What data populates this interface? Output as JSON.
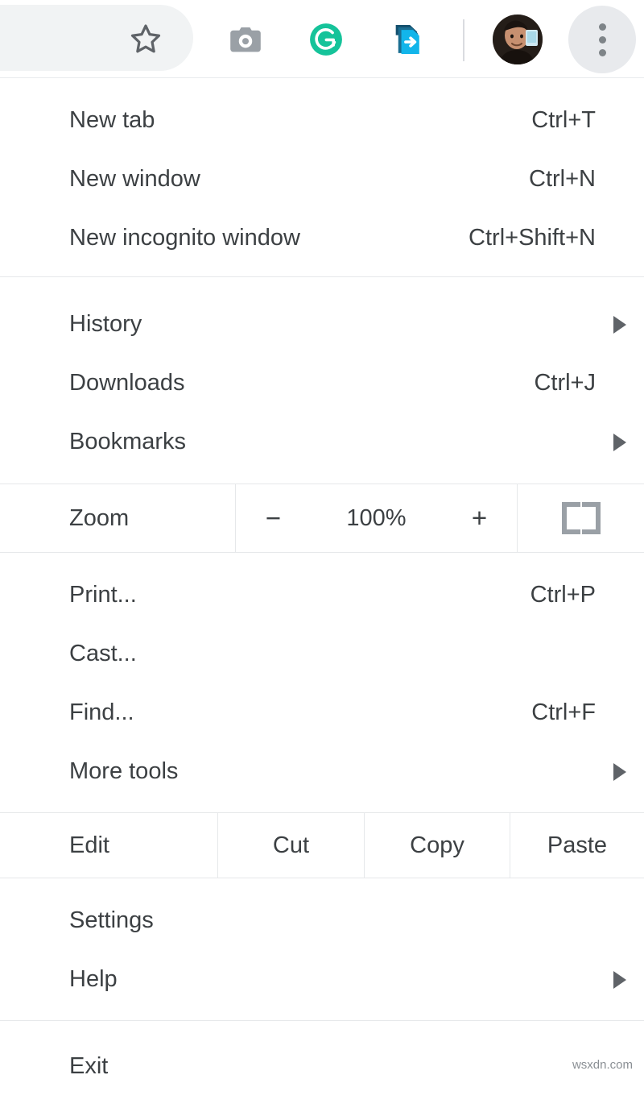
{
  "toolbar": {
    "bookmark_star_tooltip": "Bookmark this tab",
    "screenshot_tooltip": "Screenshot extension",
    "grammarly_letter": "G",
    "grammarly_tooltip": "Grammarly",
    "export_tooltip": "Save to extension",
    "avatar_tooltip": "Profile",
    "menu_tooltip": "Customize and control Google Chrome",
    "colors": {
      "omnibox_bg": "#f1f3f4",
      "icon_gray": "#8a8f94",
      "grammarly_green": "#15c39a",
      "export_blue": "#12b5ea",
      "export_navy": "#14506e",
      "menu_button_bg": "#e8eaed",
      "divider": "#e6e8ea"
    }
  },
  "menu": {
    "sections": [
      {
        "name": "new",
        "items": [
          {
            "label": "New tab",
            "accel": "Ctrl+T",
            "submenu": false
          },
          {
            "label": "New window",
            "accel": "Ctrl+N",
            "submenu": false
          },
          {
            "label": "New incognito window",
            "accel": "Ctrl+Shift+N",
            "submenu": false
          }
        ]
      },
      {
        "name": "history",
        "items": [
          {
            "label": "History",
            "accel": "",
            "submenu": true
          },
          {
            "label": "Downloads",
            "accel": "Ctrl+J",
            "submenu": false
          },
          {
            "label": "Bookmarks",
            "accel": "",
            "submenu": true
          }
        ]
      },
      {
        "name": "zoom",
        "items": [
          {
            "label": "Zoom",
            "accel": "",
            "submenu": false
          }
        ]
      },
      {
        "name": "print",
        "items": [
          {
            "label": "Print...",
            "accel": "Ctrl+P",
            "submenu": false
          },
          {
            "label": "Cast...",
            "accel": "",
            "submenu": false
          },
          {
            "label": "Find...",
            "accel": "Ctrl+F",
            "submenu": false
          },
          {
            "label": "More tools",
            "accel": "",
            "submenu": true
          }
        ]
      },
      {
        "name": "edit",
        "items": [
          {
            "label": "Edit",
            "accel": "",
            "submenu": false
          },
          {
            "label": "Cut",
            "accel": "",
            "submenu": false
          },
          {
            "label": "Copy",
            "accel": "",
            "submenu": false
          },
          {
            "label": "Paste",
            "accel": "",
            "submenu": false
          }
        ]
      },
      {
        "name": "settings",
        "items": [
          {
            "label": "Settings",
            "accel": "",
            "submenu": false
          },
          {
            "label": "Help",
            "accel": "",
            "submenu": true
          }
        ]
      },
      {
        "name": "exit",
        "items": [
          {
            "label": "Exit",
            "accel": "",
            "submenu": false
          }
        ]
      }
    ],
    "zoom_controls": {
      "minus_label": "−",
      "value": "100%",
      "plus_label": "+",
      "fullscreen_label": "Full screen"
    }
  },
  "watermark": "wsxdn.com"
}
